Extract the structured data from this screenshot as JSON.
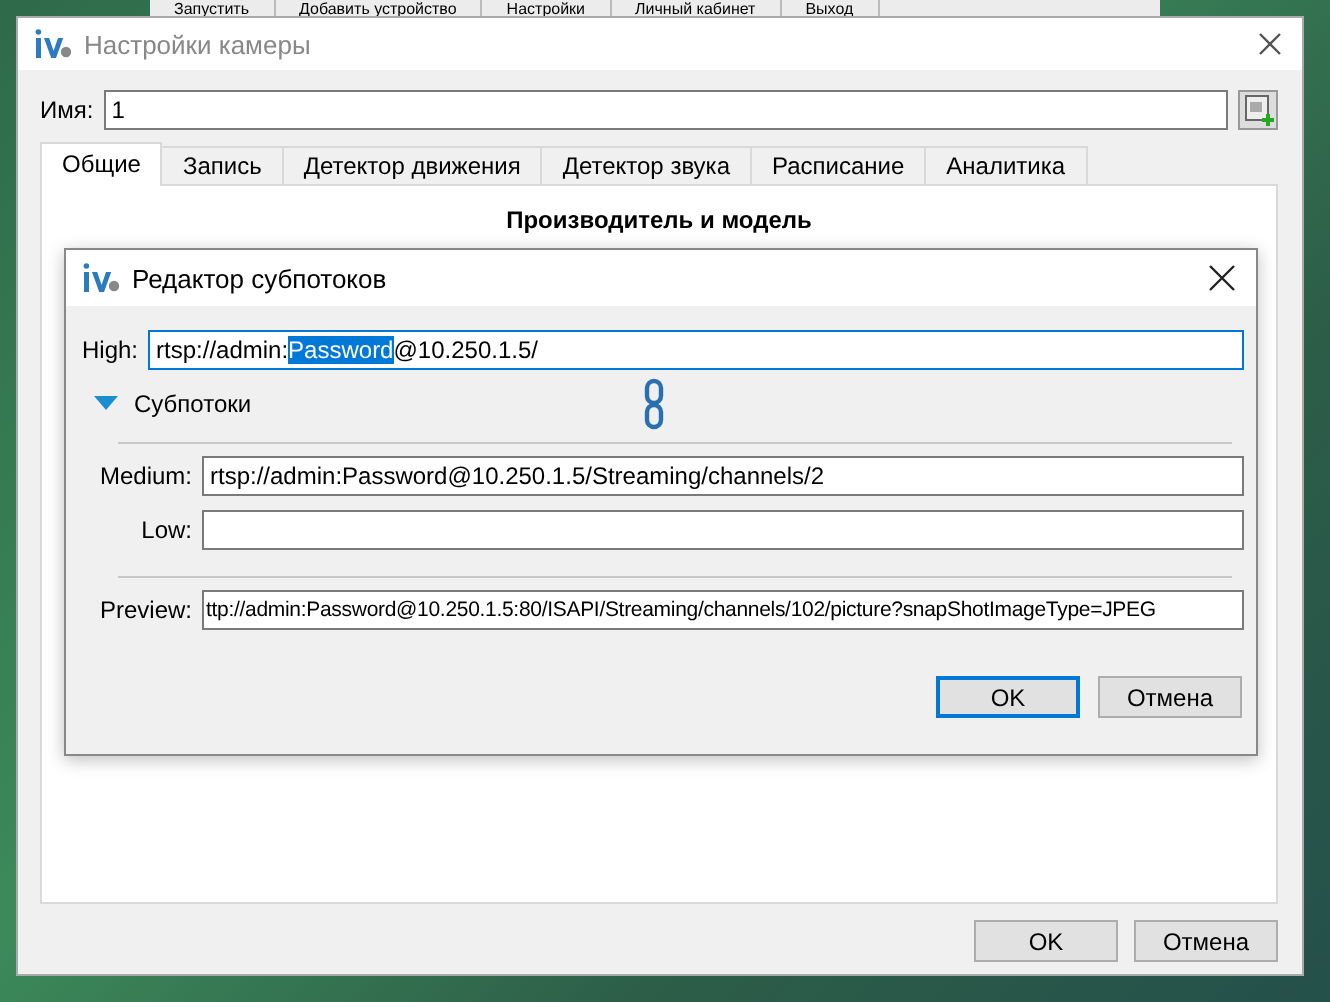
{
  "background_menu": [
    "Запустить",
    "Добавить устройство",
    "Настройки",
    "Личный кабинет",
    "Выход"
  ],
  "window": {
    "title": "Настройки камеры",
    "name_label": "Имя:",
    "name_value": "1"
  },
  "tabs": [
    {
      "label": "Общие",
      "selected": true
    },
    {
      "label": "Запись",
      "selected": false
    },
    {
      "label": "Детектор движения",
      "selected": false
    },
    {
      "label": "Детектор звука",
      "selected": false
    },
    {
      "label": "Расписание",
      "selected": false
    },
    {
      "label": "Аналитика",
      "selected": false
    }
  ],
  "section_heading": "Производитель и модель",
  "dialog": {
    "title": "Редактор субпотоков",
    "high": {
      "label": "High:",
      "text_before": "rtsp://admin:",
      "selected_text": "Password",
      "text_after": "@10.250.1.5/"
    },
    "substreams": {
      "label": "Субпотоки",
      "expanded": true
    },
    "streams": [
      {
        "label": "Medium:",
        "value": "rtsp://admin:Password@10.250.1.5/Streaming/channels/2"
      },
      {
        "label": "Low:"
      }
    ],
    "preview": {
      "label": "Preview:",
      "value": "ttp://admin:Password@10.250.1.5:80/ISAPI/Streaming/channels/102/picture?snapShotImageType=JPEG"
    },
    "buttons": [
      {
        "label": "OK",
        "default": true
      },
      {
        "label": "Отмена",
        "default": false
      }
    ]
  },
  "buttons": [
    "OK",
    "Отмена"
  ]
}
